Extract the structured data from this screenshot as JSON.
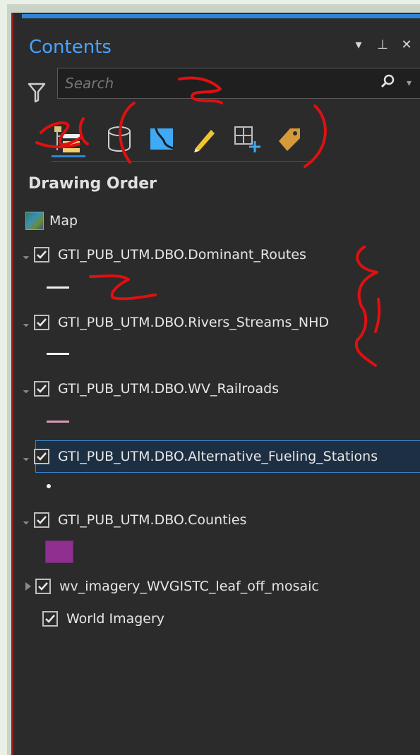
{
  "pane": {
    "title": "Contents",
    "controls": [
      "▾",
      "⊥",
      "✕"
    ]
  },
  "search": {
    "placeholder": "Search"
  },
  "toolbar": {
    "icons": [
      "list-by-drawing-order-icon",
      "list-by-data-source-icon",
      "list-by-selection-icon",
      "list-by-editing-icon",
      "list-by-snapping-icon",
      "list-by-labeling-icon"
    ]
  },
  "section": {
    "title": "Drawing Order"
  },
  "map": {
    "label": "Map"
  },
  "layers": [
    {
      "name": "GTI_PUB_UTM.DBO.Dominant_Routes",
      "checked": true,
      "symbol": "line",
      "color": "#f0f0f0"
    },
    {
      "name": "GTI_PUB_UTM.DBO.Rivers_Streams_NHD",
      "checked": true,
      "symbol": "line",
      "color": "#f0f0f0"
    },
    {
      "name": "GTI_PUB_UTM.DBO.WV_Railroads",
      "checked": true,
      "symbol": "line",
      "color": "#d79ab6"
    },
    {
      "name": "GTI_PUB_UTM.DBO.Alternative_Fueling_Stations",
      "checked": true,
      "symbol": "dot",
      "color": "#f0f0f0"
    },
    {
      "name": "GTI_PUB_UTM.DBO.Counties",
      "checked": true,
      "symbol": "fill",
      "color": "#8f2f8f"
    },
    {
      "name": "wv_imagery_WVGISTC_leaf_off_mosaic",
      "checked": true,
      "symbol": "none"
    },
    {
      "name": "World Imagery",
      "checked": true,
      "symbol": "none"
    }
  ],
  "colors": {
    "accent": "#2f86d6",
    "panel_bg": "#2b2b2b",
    "annotation_red": "#e01010"
  }
}
